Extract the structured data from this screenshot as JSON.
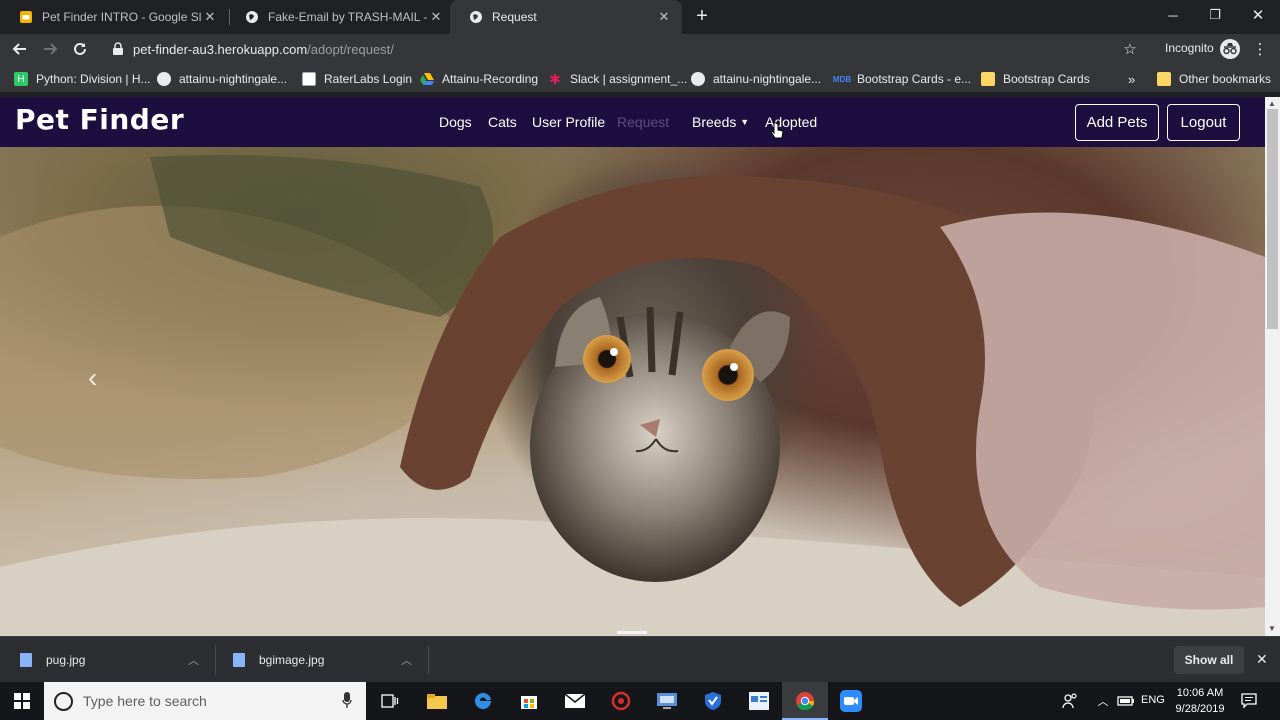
{
  "browser": {
    "tabs": [
      {
        "title": "Pet Finder INTRO - Google Slides",
        "icon": "slides-icon",
        "active": false
      },
      {
        "title": "Fake-Email by TRASH-MAIL - Fet",
        "icon": "globe-icon",
        "active": false
      },
      {
        "title": "Request",
        "icon": "globe-icon",
        "active": true
      }
    ],
    "url_host": "pet-finder-au3.herokuapp.com",
    "url_path": "/adopt/request/",
    "profile_label": "Incognito",
    "bookmarks": [
      {
        "label": "Python: Division | H...",
        "icon": "hackerrank-icon",
        "color": "#2ec866"
      },
      {
        "label": "attainu-nightingale...",
        "icon": "github-icon",
        "color": "#e8eaed"
      },
      {
        "label": "RaterLabs Login",
        "icon": "raterlabs-icon",
        "color": "#e8eaed"
      },
      {
        "label": "Attainu-Recording",
        "icon": "drive-icon",
        "color": "#fbbc04"
      },
      {
        "label": "Slack | assignment_...",
        "icon": "slack-icon",
        "color": "#e01e5a"
      },
      {
        "label": "attainu-nightingale...",
        "icon": "github-icon",
        "color": "#e8eaed"
      },
      {
        "label": "Bootstrap Cards - e...",
        "icon": "mdb-icon",
        "color": "#4285f4"
      },
      {
        "label": "Bootstrap Cards",
        "icon": "folder-icon",
        "color": "#fdd663"
      }
    ],
    "other_bookmarks": "Other bookmarks"
  },
  "page": {
    "brand": "Pet Finder",
    "nav": {
      "dogs": "Dogs",
      "cats": "Cats",
      "profile": "User Profile",
      "request": "Request",
      "breeds": "Breeds",
      "adopted": "Adopted"
    },
    "add_pets": "Add Pets",
    "logout": "Logout",
    "carousel_prev": "‹"
  },
  "downloads": {
    "items": [
      {
        "name": "pug.jpg"
      },
      {
        "name": "bgimage.jpg"
      }
    ],
    "show_all": "Show all"
  },
  "taskbar": {
    "search_placeholder": "Type here to search",
    "language": "ENG",
    "time": "10:06 AM",
    "date": "9/28/2019"
  },
  "colors": {
    "navbar": "#1c0f3f",
    "chrome_dark": "#202124",
    "chrome_toolbar": "#35363a"
  }
}
